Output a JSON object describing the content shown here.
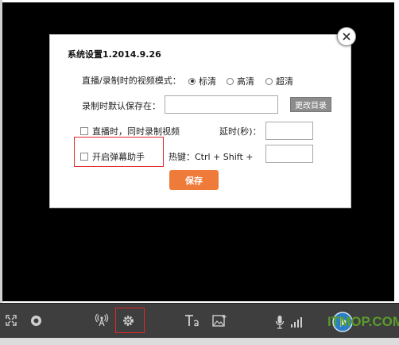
{
  "dialog": {
    "title": "系统设置1.2014.9.26",
    "video_mode_label": "直播/录制时的视频模式：",
    "video_mode_options": [
      "标清",
      "高清",
      "超清"
    ],
    "video_mode_selected": "标清",
    "save_path_label": "录制时默认保存在：",
    "save_path_value": "",
    "change_dir_label": "更改目录",
    "record_while_live_label": "直播时，同时录制视频",
    "record_while_live_checked": false,
    "delay_label": "延时(秒)：",
    "delay_value": "",
    "danmaku_helper_label": "开启弹幕助手",
    "danmaku_helper_checked": false,
    "hotkey_label": "热键：Ctrl + Shift +",
    "hotkey_value": "",
    "save_label": "保存"
  },
  "toolbar": {
    "icons": [
      "fullscreen-icon",
      "record-icon",
      "broadcast-icon",
      "settings-icon",
      "text-icon",
      "image-icon",
      "microphone-icon",
      "signal-icon",
      "play-icon"
    ]
  },
  "watermark": {
    "text": "ITMOP.COM"
  },
  "colors": {
    "accent": "#ef7b3a",
    "highlight": "#e0282b",
    "toolbar": "#3e3e3e"
  }
}
